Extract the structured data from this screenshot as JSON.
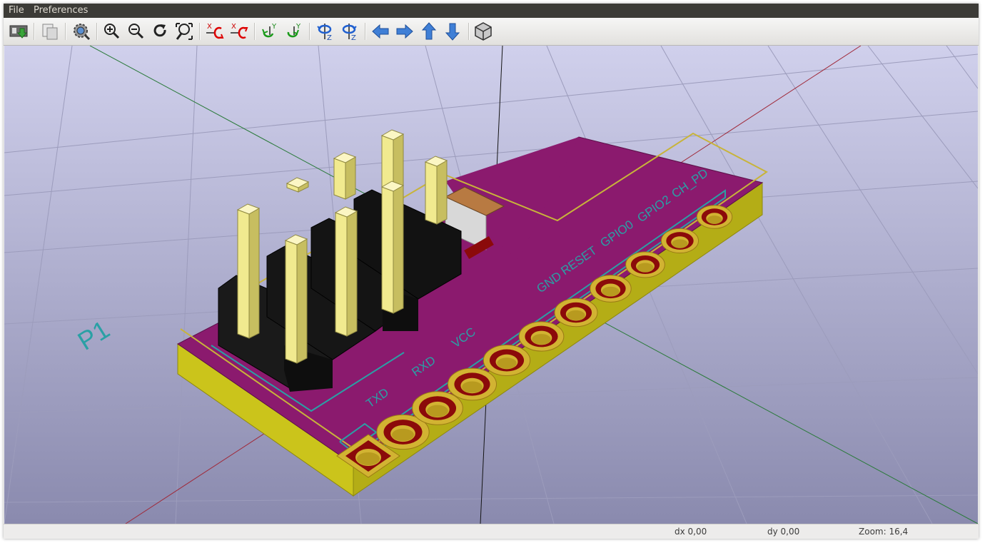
{
  "menu": {
    "file": "File",
    "preferences": "Preferences"
  },
  "toolbar": {
    "buttons": [
      {
        "id": "reload-board",
        "icon": "reload-board-icon"
      },
      {
        "id": "copy-to-clipboard",
        "icon": "copy-icon"
      },
      {
        "id": "display-options",
        "icon": "gear-icon"
      },
      {
        "id": "zoom-in",
        "icon": "zoom-in-icon"
      },
      {
        "id": "zoom-out",
        "icon": "zoom-out-icon"
      },
      {
        "id": "redraw",
        "icon": "redraw-icon"
      },
      {
        "id": "zoom-fit",
        "icon": "zoom-fit-icon"
      },
      {
        "id": "rotate-x-ccw",
        "icon": "rotate-x-icon"
      },
      {
        "id": "rotate-x-cw",
        "icon": "rotate-x-icon"
      },
      {
        "id": "rotate-y-ccw",
        "icon": "rotate-y-icon"
      },
      {
        "id": "rotate-y-cw",
        "icon": "rotate-y-icon"
      },
      {
        "id": "rotate-z-ccw",
        "icon": "rotate-z-icon"
      },
      {
        "id": "rotate-z-cw",
        "icon": "rotate-z-icon"
      },
      {
        "id": "move-left",
        "icon": "arrow-left-icon"
      },
      {
        "id": "move-right",
        "icon": "arrow-right-icon"
      },
      {
        "id": "move-up",
        "icon": "arrow-up-icon"
      },
      {
        "id": "move-down",
        "icon": "arrow-down-icon"
      },
      {
        "id": "orthographic-toggle",
        "icon": "cube-icon"
      }
    ],
    "axis_labels": {
      "x": "X",
      "y": "Y",
      "z": "Z"
    }
  },
  "board": {
    "reference": "P1",
    "pin_labels": [
      "TXD",
      "RXD",
      "VCC",
      "GND",
      "RESET",
      "GPIO0",
      "GPIO2",
      "CH_PD"
    ]
  },
  "status": {
    "dx": "dx 0,00",
    "dy": "dy 0,00",
    "zoom": "Zoom: 16,4"
  },
  "colors": {
    "menubar": "#3c3b37",
    "background_top": "#d0d0ec",
    "background_bottom": "#8a8aae",
    "board_top": "#8b1a6e",
    "board_edge": "#c9c217",
    "pad_copper": "#8b0a0a",
    "pad_ring": "#d2b332",
    "silkscreen": "#2aa0a5",
    "header_body": "#161616",
    "pin_gold": "#e9e07e"
  }
}
